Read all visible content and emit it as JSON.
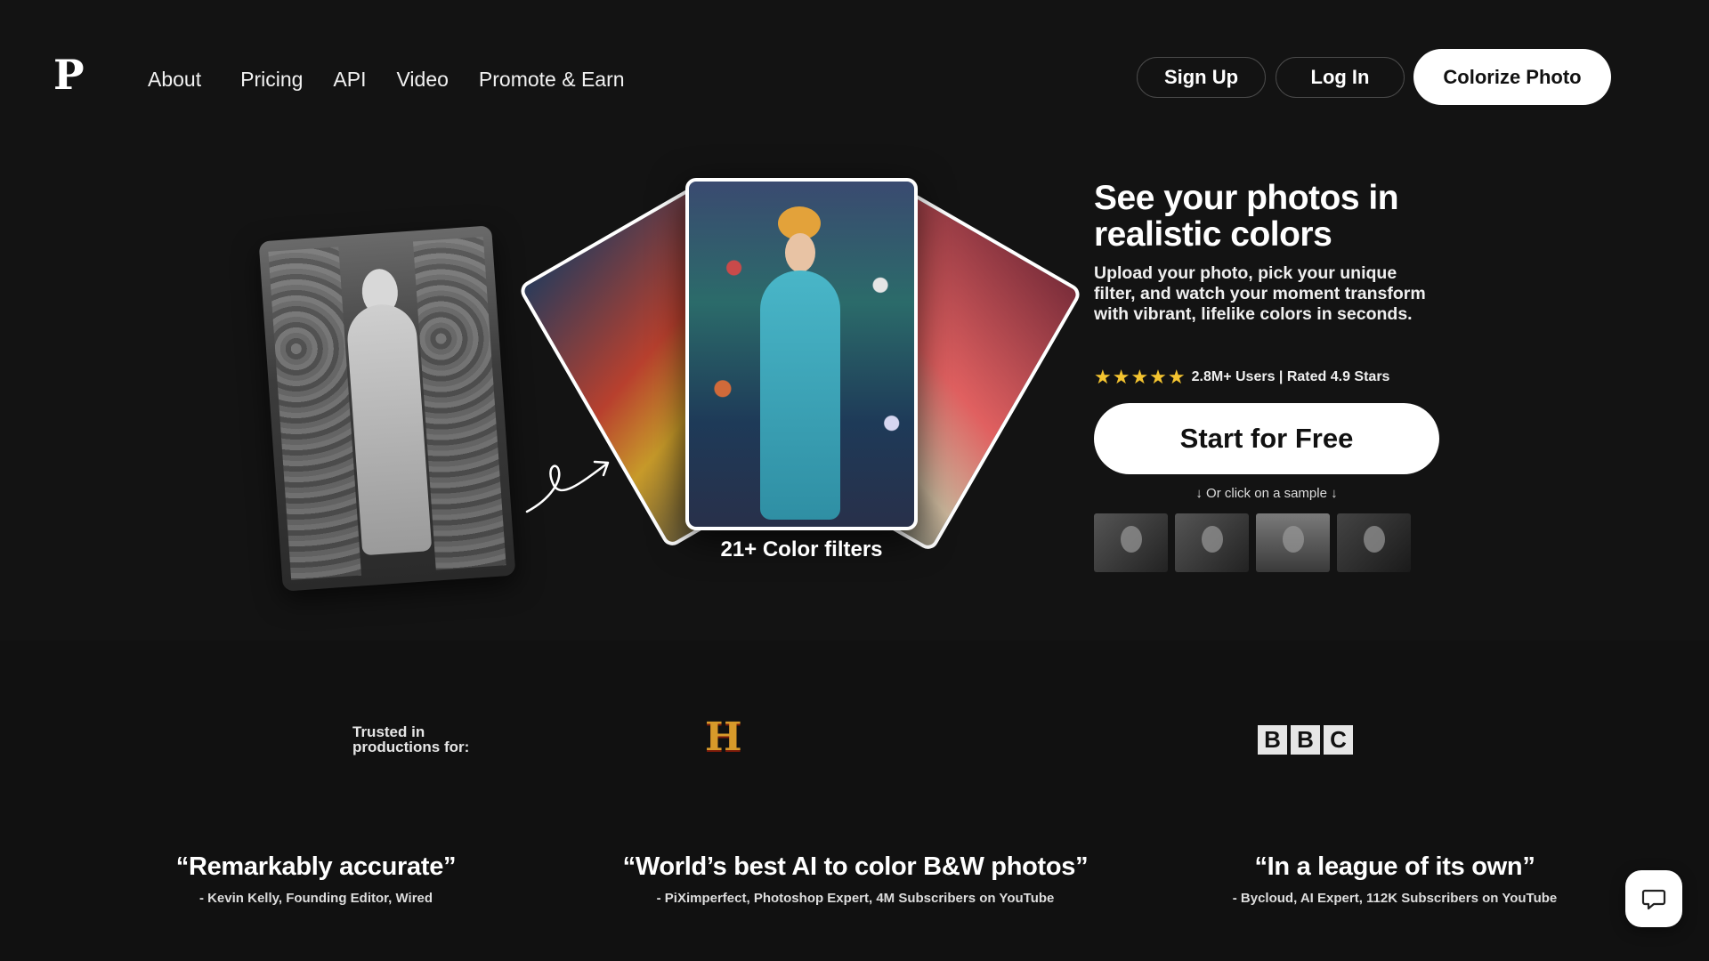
{
  "header": {
    "logo_text": "P",
    "nav": [
      "About",
      "Pricing",
      "API",
      "Video",
      "Promote & Earn"
    ],
    "signup_label": "Sign Up",
    "login_label": "Log In",
    "colorize_label": "Colorize Photo"
  },
  "hero": {
    "filters_caption": "21+ Color filters",
    "title": "See your photos in realistic colors",
    "subtitle": "Upload your photo, pick your unique filter, and watch your moment transform with vibrant, lifelike colors in seconds.",
    "stars": "★★★★★",
    "rating_text": "2.8M+ Users | Rated 4.9 Stars",
    "start_label": "Start for Free",
    "sample_caption": "↓ Or click on a sample ↓"
  },
  "trusted": {
    "label": "Trusted in productions for:",
    "history_logo": "H",
    "bbc_letters": [
      "B",
      "B",
      "C"
    ]
  },
  "quotes": [
    {
      "quote": "“Remarkably accurate”",
      "author": "- Kevin Kelly, Founding Editor, Wired"
    },
    {
      "quote": "“World’s best AI to color B&W photos”",
      "author": "- PiXimperfect, Photoshop Expert, 4M Subscribers on YouTube"
    },
    {
      "quote": "“In a league of its own”",
      "author": "- Bycloud, AI Expert, 112K Subscribers on YouTube"
    }
  ],
  "colors": {
    "background": "#131313",
    "accent": "#ffffff",
    "star": "#f4c430"
  }
}
